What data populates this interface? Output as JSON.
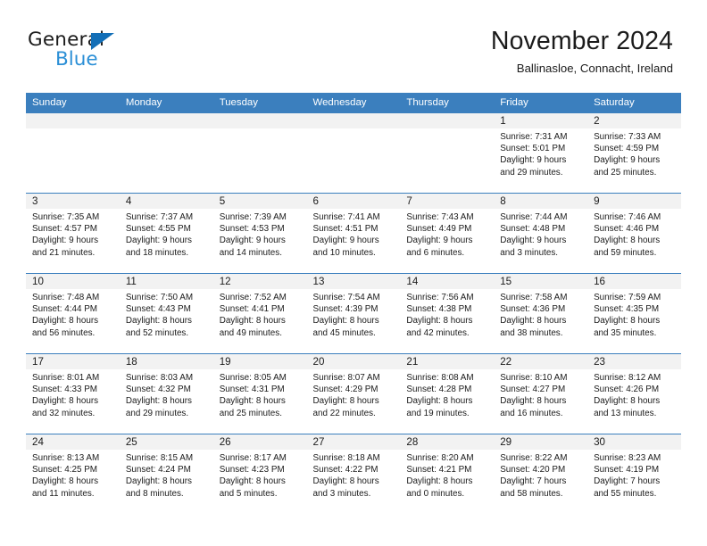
{
  "brand": {
    "name_part1": "General",
    "name_part2": "Blue",
    "triangle_color": "#136fb7",
    "blue_text_color": "#2b8fd6"
  },
  "header": {
    "title": "November 2024",
    "subtitle": "Ballinasloe, Connacht, Ireland"
  },
  "theme": {
    "header_row_bg": "#3b7fbe",
    "header_row_text": "#ffffff",
    "daynum_band_bg": "#f2f2f2",
    "grid_line": "#3b7fbe",
    "cell_bg": "#ffffff",
    "text": "#1b1b1b"
  },
  "weekday_headers": [
    "Sunday",
    "Monday",
    "Tuesday",
    "Wednesday",
    "Thursday",
    "Friday",
    "Saturday"
  ],
  "labels": {
    "sunrise_prefix": "Sunrise:",
    "sunset_prefix": "Sunset:",
    "daylight_prefix": "Daylight:"
  },
  "weeks": [
    [
      {
        "day": "",
        "empty": true
      },
      {
        "day": "",
        "empty": true
      },
      {
        "day": "",
        "empty": true
      },
      {
        "day": "",
        "empty": true
      },
      {
        "day": "",
        "empty": true
      },
      {
        "day": "1",
        "sunrise": "Sunrise: 7:31 AM",
        "sunset": "Sunset: 5:01 PM",
        "daylight_line1": "Daylight: 9 hours",
        "daylight_line2": "and 29 minutes."
      },
      {
        "day": "2",
        "sunrise": "Sunrise: 7:33 AM",
        "sunset": "Sunset: 4:59 PM",
        "daylight_line1": "Daylight: 9 hours",
        "daylight_line2": "and 25 minutes."
      }
    ],
    [
      {
        "day": "3",
        "sunrise": "Sunrise: 7:35 AM",
        "sunset": "Sunset: 4:57 PM",
        "daylight_line1": "Daylight: 9 hours",
        "daylight_line2": "and 21 minutes."
      },
      {
        "day": "4",
        "sunrise": "Sunrise: 7:37 AM",
        "sunset": "Sunset: 4:55 PM",
        "daylight_line1": "Daylight: 9 hours",
        "daylight_line2": "and 18 minutes."
      },
      {
        "day": "5",
        "sunrise": "Sunrise: 7:39 AM",
        "sunset": "Sunset: 4:53 PM",
        "daylight_line1": "Daylight: 9 hours",
        "daylight_line2": "and 14 minutes."
      },
      {
        "day": "6",
        "sunrise": "Sunrise: 7:41 AM",
        "sunset": "Sunset: 4:51 PM",
        "daylight_line1": "Daylight: 9 hours",
        "daylight_line2": "and 10 minutes."
      },
      {
        "day": "7",
        "sunrise": "Sunrise: 7:43 AM",
        "sunset": "Sunset: 4:49 PM",
        "daylight_line1": "Daylight: 9 hours",
        "daylight_line2": "and 6 minutes."
      },
      {
        "day": "8",
        "sunrise": "Sunrise: 7:44 AM",
        "sunset": "Sunset: 4:48 PM",
        "daylight_line1": "Daylight: 9 hours",
        "daylight_line2": "and 3 minutes."
      },
      {
        "day": "9",
        "sunrise": "Sunrise: 7:46 AM",
        "sunset": "Sunset: 4:46 PM",
        "daylight_line1": "Daylight: 8 hours",
        "daylight_line2": "and 59 minutes."
      }
    ],
    [
      {
        "day": "10",
        "sunrise": "Sunrise: 7:48 AM",
        "sunset": "Sunset: 4:44 PM",
        "daylight_line1": "Daylight: 8 hours",
        "daylight_line2": "and 56 minutes."
      },
      {
        "day": "11",
        "sunrise": "Sunrise: 7:50 AM",
        "sunset": "Sunset: 4:43 PM",
        "daylight_line1": "Daylight: 8 hours",
        "daylight_line2": "and 52 minutes."
      },
      {
        "day": "12",
        "sunrise": "Sunrise: 7:52 AM",
        "sunset": "Sunset: 4:41 PM",
        "daylight_line1": "Daylight: 8 hours",
        "daylight_line2": "and 49 minutes."
      },
      {
        "day": "13",
        "sunrise": "Sunrise: 7:54 AM",
        "sunset": "Sunset: 4:39 PM",
        "daylight_line1": "Daylight: 8 hours",
        "daylight_line2": "and 45 minutes."
      },
      {
        "day": "14",
        "sunrise": "Sunrise: 7:56 AM",
        "sunset": "Sunset: 4:38 PM",
        "daylight_line1": "Daylight: 8 hours",
        "daylight_line2": "and 42 minutes."
      },
      {
        "day": "15",
        "sunrise": "Sunrise: 7:58 AM",
        "sunset": "Sunset: 4:36 PM",
        "daylight_line1": "Daylight: 8 hours",
        "daylight_line2": "and 38 minutes."
      },
      {
        "day": "16",
        "sunrise": "Sunrise: 7:59 AM",
        "sunset": "Sunset: 4:35 PM",
        "daylight_line1": "Daylight: 8 hours",
        "daylight_line2": "and 35 minutes."
      }
    ],
    [
      {
        "day": "17",
        "sunrise": "Sunrise: 8:01 AM",
        "sunset": "Sunset: 4:33 PM",
        "daylight_line1": "Daylight: 8 hours",
        "daylight_line2": "and 32 minutes."
      },
      {
        "day": "18",
        "sunrise": "Sunrise: 8:03 AM",
        "sunset": "Sunset: 4:32 PM",
        "daylight_line1": "Daylight: 8 hours",
        "daylight_line2": "and 29 minutes."
      },
      {
        "day": "19",
        "sunrise": "Sunrise: 8:05 AM",
        "sunset": "Sunset: 4:31 PM",
        "daylight_line1": "Daylight: 8 hours",
        "daylight_line2": "and 25 minutes."
      },
      {
        "day": "20",
        "sunrise": "Sunrise: 8:07 AM",
        "sunset": "Sunset: 4:29 PM",
        "daylight_line1": "Daylight: 8 hours",
        "daylight_line2": "and 22 minutes."
      },
      {
        "day": "21",
        "sunrise": "Sunrise: 8:08 AM",
        "sunset": "Sunset: 4:28 PM",
        "daylight_line1": "Daylight: 8 hours",
        "daylight_line2": "and 19 minutes."
      },
      {
        "day": "22",
        "sunrise": "Sunrise: 8:10 AM",
        "sunset": "Sunset: 4:27 PM",
        "daylight_line1": "Daylight: 8 hours",
        "daylight_line2": "and 16 minutes."
      },
      {
        "day": "23",
        "sunrise": "Sunrise: 8:12 AM",
        "sunset": "Sunset: 4:26 PM",
        "daylight_line1": "Daylight: 8 hours",
        "daylight_line2": "and 13 minutes."
      }
    ],
    [
      {
        "day": "24",
        "sunrise": "Sunrise: 8:13 AM",
        "sunset": "Sunset: 4:25 PM",
        "daylight_line1": "Daylight: 8 hours",
        "daylight_line2": "and 11 minutes."
      },
      {
        "day": "25",
        "sunrise": "Sunrise: 8:15 AM",
        "sunset": "Sunset: 4:24 PM",
        "daylight_line1": "Daylight: 8 hours",
        "daylight_line2": "and 8 minutes."
      },
      {
        "day": "26",
        "sunrise": "Sunrise: 8:17 AM",
        "sunset": "Sunset: 4:23 PM",
        "daylight_line1": "Daylight: 8 hours",
        "daylight_line2": "and 5 minutes."
      },
      {
        "day": "27",
        "sunrise": "Sunrise: 8:18 AM",
        "sunset": "Sunset: 4:22 PM",
        "daylight_line1": "Daylight: 8 hours",
        "daylight_line2": "and 3 minutes."
      },
      {
        "day": "28",
        "sunrise": "Sunrise: 8:20 AM",
        "sunset": "Sunset: 4:21 PM",
        "daylight_line1": "Daylight: 8 hours",
        "daylight_line2": "and 0 minutes."
      },
      {
        "day": "29",
        "sunrise": "Sunrise: 8:22 AM",
        "sunset": "Sunset: 4:20 PM",
        "daylight_line1": "Daylight: 7 hours",
        "daylight_line2": "and 58 minutes."
      },
      {
        "day": "30",
        "sunrise": "Sunrise: 8:23 AM",
        "sunset": "Sunset: 4:19 PM",
        "daylight_line1": "Daylight: 7 hours",
        "daylight_line2": "and 55 minutes."
      }
    ]
  ]
}
